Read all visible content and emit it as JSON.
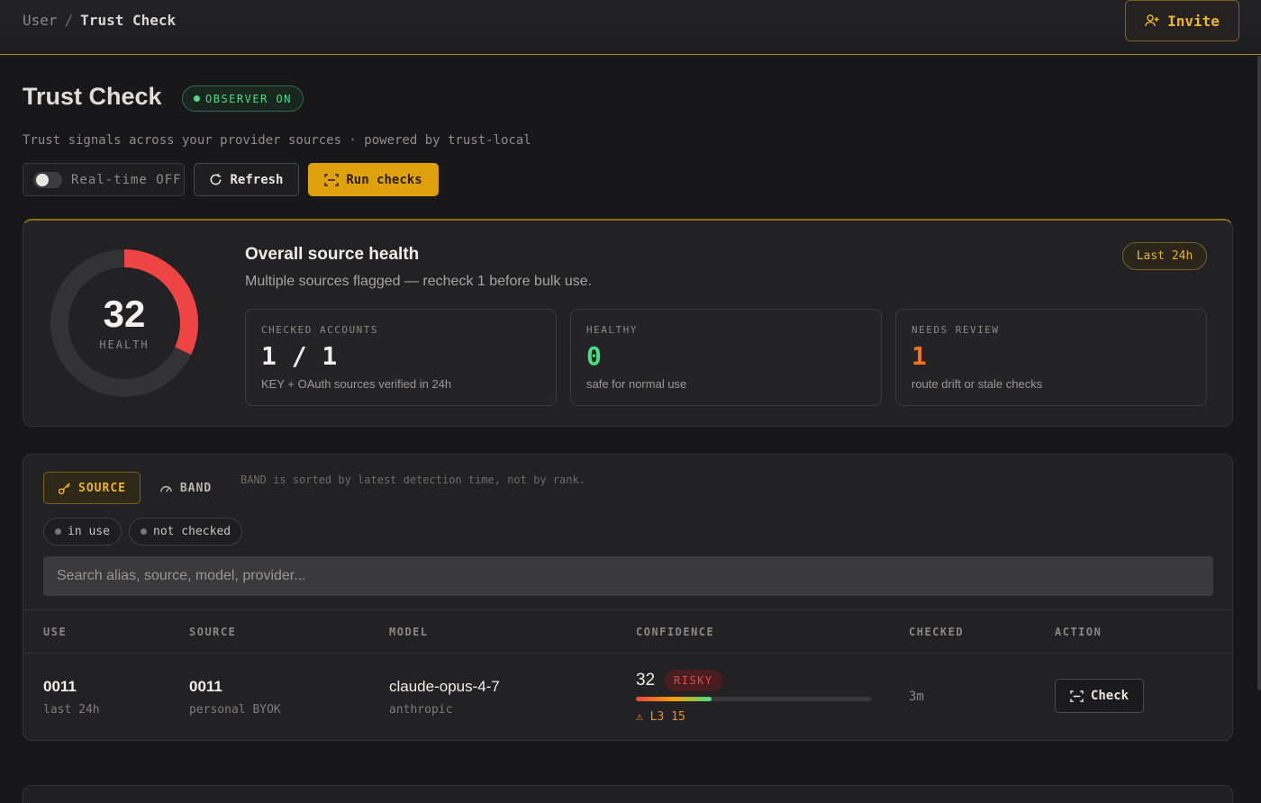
{
  "breadcrumb": {
    "parent": "User",
    "separator": "/",
    "current": "Trust Check"
  },
  "header": {
    "invite_label": "Invite",
    "title": "Trust Check",
    "observer_badge": "OBSERVER ON",
    "subtitle": "Trust signals across your provider sources · powered by trust-local"
  },
  "toolbar": {
    "realtime_label": "Real-time OFF",
    "realtime_on": false,
    "refresh_label": "Refresh",
    "run_label": "Run checks"
  },
  "health": {
    "score": "32",
    "score_value": 32,
    "score_label": "HEALTH",
    "title": "Overall source health",
    "description": "Multiple sources flagged — recheck 1 before bulk use.",
    "range_badge": "Last 24h",
    "stats": [
      {
        "label": "CHECKED ACCOUNTS",
        "value": "1 / 1",
        "note": "KEY + OAuth sources verified in 24h",
        "color": "#f0eee9"
      },
      {
        "label": "HEALTHY",
        "value": "0",
        "note": "safe for normal use",
        "color": "#4ade80"
      },
      {
        "label": "NEEDS REVIEW",
        "value": "1",
        "note": "route drift or stale checks",
        "color": "#f97316"
      }
    ]
  },
  "sources": {
    "tabs": [
      {
        "label": "SOURCE",
        "active": true
      },
      {
        "label": "BAND",
        "active": false
      }
    ],
    "band_note": "BAND is sorted by latest detection time, not by rank.",
    "filters": [
      "in use",
      "not checked"
    ],
    "search_placeholder": "Search alias, source, model, provider...",
    "columns": [
      "USE",
      "SOURCE",
      "MODEL",
      "CONFIDENCE",
      "CHECKED",
      "ACTION"
    ],
    "rows": [
      {
        "use": "0011",
        "use_sub": "last 24h",
        "source": "0011",
        "source_sub": "personal BYOK",
        "model": "claude-opus-4-7",
        "model_sub": "anthropic",
        "confidence": "32",
        "confidence_value": 0.32,
        "badge": "RISKY",
        "warning": "⚠ L3 15",
        "checked": "3m",
        "action": "Check"
      }
    ]
  },
  "colors": {
    "accent": "#f0b429",
    "danger": "#ef4444",
    "healthy": "#4ade80",
    "review": "#f97316"
  }
}
